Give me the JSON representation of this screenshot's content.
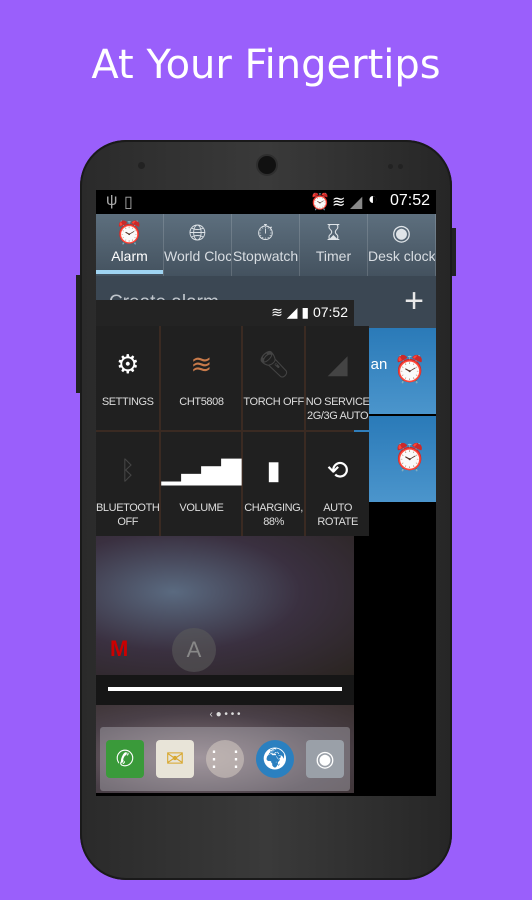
{
  "headline": "At Your Fingertips",
  "status": {
    "time": "07:52",
    "icons": [
      "usb-icon",
      "screenshot-icon",
      "alarm-icon",
      "wifi-icon",
      "signal-icon",
      "battery-icon"
    ]
  },
  "tabs": [
    {
      "label": "Alarm",
      "icon": "alarm-icon"
    },
    {
      "label": "World Cloc",
      "icon": "globe-icon"
    },
    {
      "label": "Stopwatch",
      "icon": "stopwatch-icon"
    },
    {
      "label": "Timer",
      "icon": "hourglass-icon"
    },
    {
      "label": "Desk clock",
      "icon": "desk-clock-icon"
    }
  ],
  "header": {
    "title": "Create alarm",
    "add": "+"
  },
  "alarm_items": [
    {
      "text": "ın an"
    }
  ],
  "shade": {
    "time": "07:52",
    "tiles": [
      {
        "l1": "SETTINGS",
        "l2": ""
      },
      {
        "l1": "CHT5808",
        "l2": ""
      },
      {
        "l1": "TORCH OFF",
        "l2": ""
      },
      {
        "l1": "NO SERVICE",
        "l2": "2G/3G AUTO"
      },
      {
        "l1": "BLUETOOTH",
        "l2": "OFF"
      },
      {
        "l1": "VOLUME",
        "l2": ""
      },
      {
        "l1": "CHARGING,",
        "l2": "88%"
      },
      {
        "l1": "AUTO",
        "l2": "ROTATE"
      }
    ]
  },
  "colors": {
    "background": "#9a5ffb",
    "wifi_tile": "#c87a4a",
    "active_tab": "#9fd4f2",
    "alarm_on": "#8be02a"
  },
  "dock": [
    "phone-icon",
    "email-icon",
    "apps-icon",
    "browser-icon",
    "camera-icon"
  ]
}
